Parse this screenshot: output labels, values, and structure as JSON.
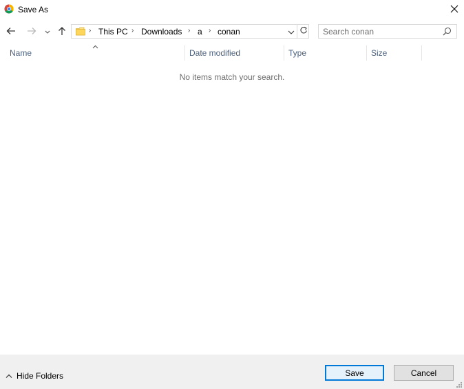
{
  "window": {
    "title": "Save As",
    "app_icon": "chrome-icon"
  },
  "nav": {
    "back_icon": "arrow-left-icon",
    "forward_icon": "arrow-right-icon",
    "recent_icon": "chevron-down-icon",
    "up_icon": "arrow-up-icon"
  },
  "address": {
    "breadcrumbs": [
      "This PC",
      "Downloads",
      "a",
      "conan"
    ],
    "folder_icon": "folder-icon",
    "refresh_icon": "refresh-icon"
  },
  "search": {
    "placeholder": "Search conan",
    "value": ""
  },
  "columns": [
    "Name",
    "Date modified",
    "Type",
    "Size"
  ],
  "sort": {
    "column": "Name",
    "direction": "ascending"
  },
  "list": {
    "empty_message": "No items match your search."
  },
  "footer": {
    "hide_folders_label": "Hide Folders",
    "save_label": "Save",
    "cancel_label": "Cancel"
  },
  "colors": {
    "header_text": "#4c607a",
    "accent": "#0078d7",
    "footer_bg": "#f0f0f0"
  }
}
